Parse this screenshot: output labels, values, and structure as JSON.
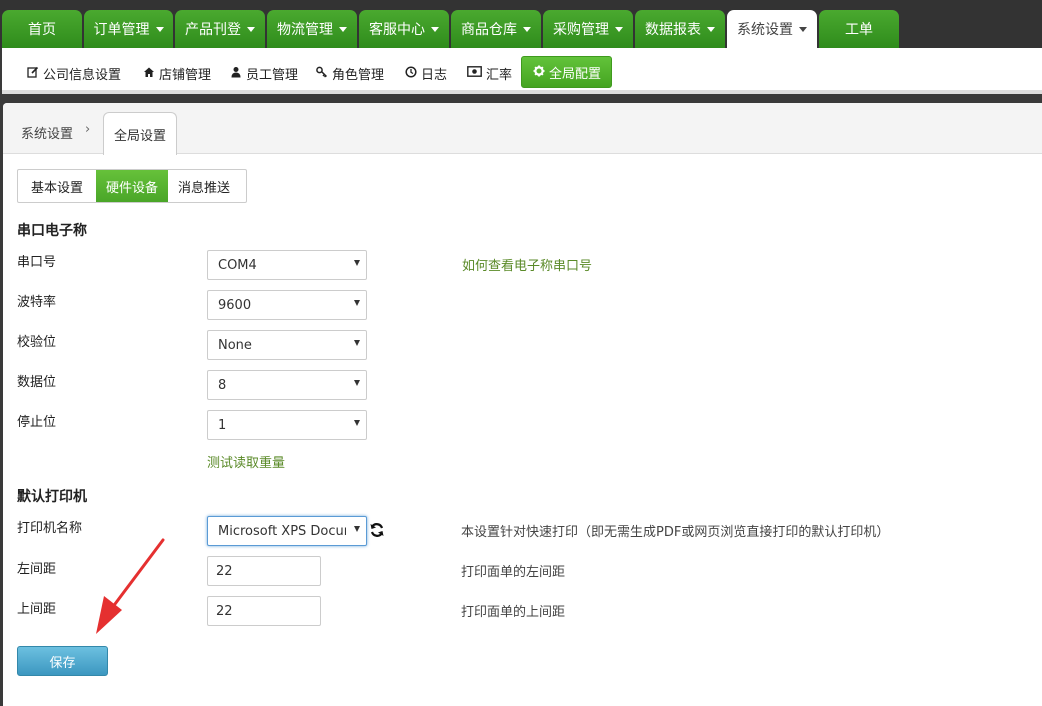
{
  "topnav": {
    "items": [
      {
        "label": "首页",
        "dropdown": false
      },
      {
        "label": "订单管理",
        "dropdown": true
      },
      {
        "label": "产品刊登",
        "dropdown": true
      },
      {
        "label": "物流管理",
        "dropdown": true
      },
      {
        "label": "客服中心",
        "dropdown": true
      },
      {
        "label": "商品仓库",
        "dropdown": true
      },
      {
        "label": "采购管理",
        "dropdown": true
      },
      {
        "label": "数据报表",
        "dropdown": true
      },
      {
        "label": "系统设置",
        "dropdown": true,
        "active": true
      },
      {
        "label": "工单",
        "dropdown": false
      }
    ]
  },
  "subnav": {
    "items": [
      {
        "label": "公司信息设置",
        "icon": "edit-icon"
      },
      {
        "label": "店铺管理",
        "icon": "home-icon"
      },
      {
        "label": "员工管理",
        "icon": "user-icon"
      },
      {
        "label": "角色管理",
        "icon": "key-icon"
      },
      {
        "label": "日志",
        "icon": "clock-icon"
      },
      {
        "label": "汇率",
        "icon": "money-icon"
      },
      {
        "label": "全局配置",
        "icon": "gear-icon",
        "active": true
      }
    ]
  },
  "breadcrumb": {
    "root": "系统设置",
    "separator": "›",
    "current": "全局设置"
  },
  "tabs": [
    {
      "label": "基本设置"
    },
    {
      "label": "硬件设备",
      "active": true
    },
    {
      "label": "消息推送"
    }
  ],
  "scale": {
    "title": "串口电子称",
    "port": {
      "label": "串口号",
      "value": "COM4"
    },
    "baud": {
      "label": "波特率",
      "value": "9600"
    },
    "parity": {
      "label": "校验位",
      "value": "None"
    },
    "databits": {
      "label": "数据位",
      "value": "8"
    },
    "stopbits": {
      "label": "停止位",
      "value": "1"
    },
    "help_link": "如何查看电子称串口号",
    "test_link": "测试读取重量"
  },
  "printer": {
    "title": "默认打印机",
    "name": {
      "label": "打印机名称",
      "value": "Microsoft XPS Document Writer",
      "hint": "本设置针对快速打印（即无需生成PDF或网页浏览直接打印的默认打印机）"
    },
    "left_margin": {
      "label": "左间距",
      "value": "22",
      "hint": "打印面单的左间距"
    },
    "top_margin": {
      "label": "上间距",
      "value": "22",
      "hint": "打印面单的上间距"
    }
  },
  "actions": {
    "save_label": "保存"
  },
  "colors": {
    "nav_green": "#3c9a28",
    "active_green": "#52b52a",
    "link_green": "#5a8a28",
    "save_blue": "#4aa6cc",
    "annotation_red": "#e53030"
  }
}
